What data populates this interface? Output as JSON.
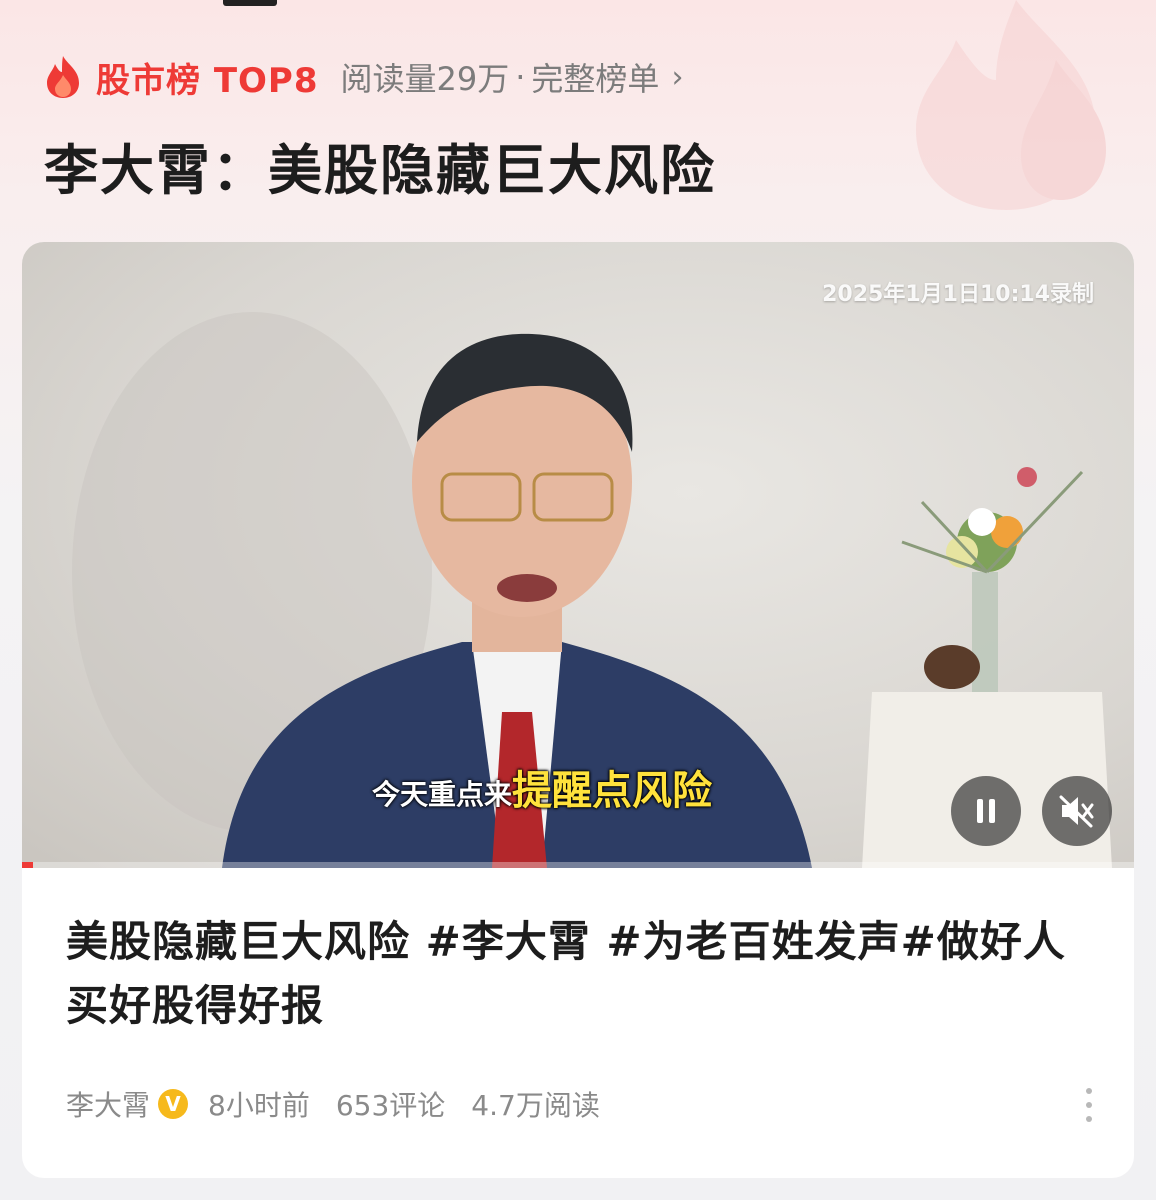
{
  "ranking": {
    "icon": "flame-icon",
    "label": "股市榜 TOP8",
    "read_count": "阅读量29万",
    "separator": "·",
    "full_list": "完整榜单",
    "chevron": "›"
  },
  "headline": "李大霄：美股隐藏巨大风险",
  "video": {
    "timestamp": "2025年1月1日10:14录制",
    "subtitle_plain": "今天重点来",
    "subtitle_highlight": "提醒点风险",
    "progress": 0.01,
    "controls": {
      "pause_icon": "pause-icon",
      "mute_icon": "volume-muted-icon"
    }
  },
  "post": {
    "description": "美股隐藏巨大风险 #李大霄 #为老百姓发声#做好人买好股得好报",
    "author": "李大霄",
    "verified_badge": "V",
    "time": "8小时前",
    "comments": "653评论",
    "reads": "4.7万阅读",
    "more_icon": "more-vertical-icon"
  },
  "colors": {
    "accent": "#ee3a36",
    "badge": "#f6b91c",
    "subtitle_highlight": "#ffe23c"
  }
}
